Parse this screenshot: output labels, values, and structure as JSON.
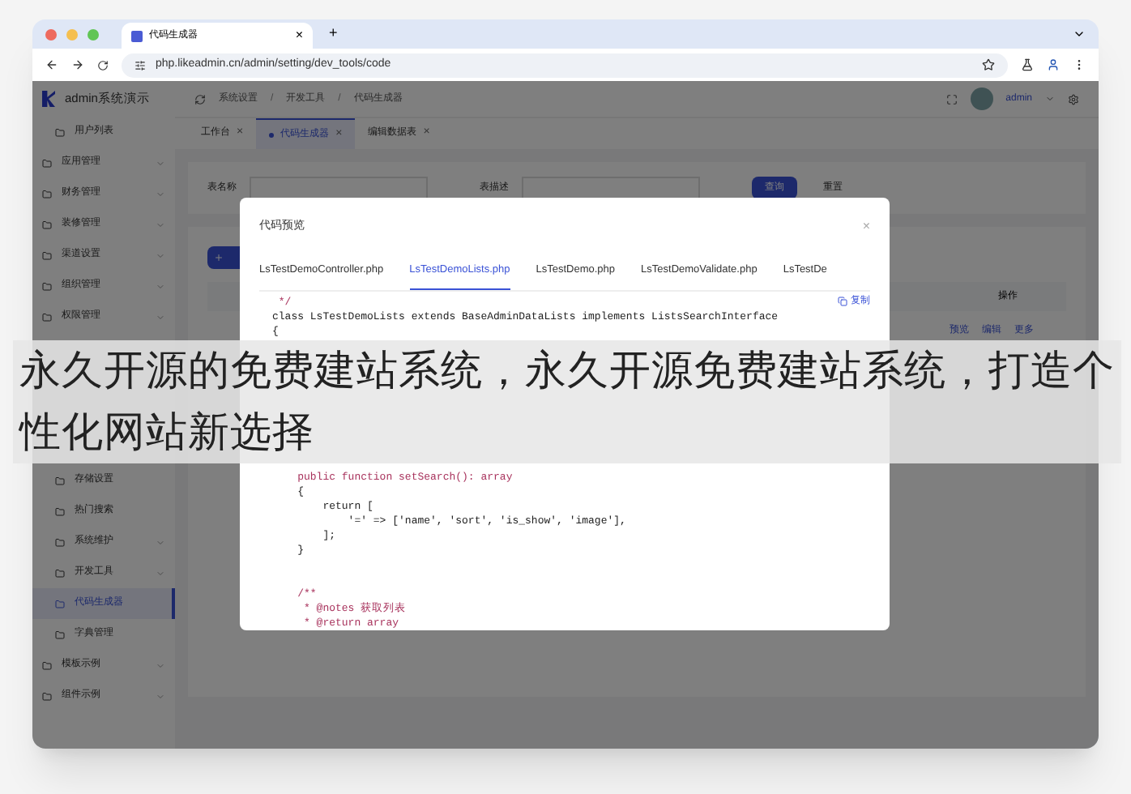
{
  "browser": {
    "tab_title": "代码生成器",
    "tab_close": "×",
    "new_tab": "+",
    "url": "php.likeadmin.cn/admin/setting/dev_tools/code"
  },
  "app": {
    "logo_text": "admin系统演示",
    "breadcrumb": [
      "系统设置",
      "开发工具",
      "代码生成器"
    ],
    "breadcrumb_separator": "/",
    "user": "admin"
  },
  "sidebar": {
    "items": [
      {
        "label": "用户列表",
        "sub": true,
        "selected": false,
        "caret": false
      },
      {
        "label": "应用管理",
        "sub": false,
        "selected": false,
        "caret": true
      },
      {
        "label": "财务管理",
        "sub": false,
        "selected": false,
        "caret": true
      },
      {
        "label": "装修管理",
        "sub": false,
        "selected": false,
        "caret": true
      },
      {
        "label": "渠道设置",
        "sub": false,
        "selected": false,
        "caret": true
      },
      {
        "label": "组织管理",
        "sub": false,
        "selected": false,
        "caret": true
      },
      {
        "label": "权限管理",
        "sub": false,
        "selected": false,
        "caret": true
      }
    ],
    "items_below_caption": [
      {
        "label": "存储设置",
        "sub": true,
        "selected": false,
        "caret": false
      },
      {
        "label": "热门搜索",
        "sub": true,
        "selected": false,
        "caret": false
      },
      {
        "label": "系统维护",
        "sub": true,
        "selected": false,
        "caret": true
      },
      {
        "label": "开发工具",
        "sub": true,
        "selected": false,
        "caret": true
      },
      {
        "label": "代码生成器",
        "sub": true,
        "selected": true,
        "caret": false
      },
      {
        "label": "字典管理",
        "sub": true,
        "selected": false,
        "caret": false
      },
      {
        "label": "模板示例",
        "sub": false,
        "selected": false,
        "caret": true
      },
      {
        "label": "组件示例",
        "sub": false,
        "selected": false,
        "caret": true
      }
    ]
  },
  "page_tabs": [
    {
      "label": "工作台",
      "close": "×",
      "selected": false
    },
    {
      "label": "代码生成器",
      "close": "×",
      "selected": true
    },
    {
      "label": "编辑数据表",
      "close": "×",
      "selected": false
    }
  ],
  "search_form": {
    "fields": [
      {
        "label": "表名称"
      },
      {
        "label": "表描述"
      }
    ],
    "buttons": [
      "查询",
      "重置"
    ]
  },
  "table": {
    "columns": [
      "操作"
    ],
    "row_actions": [
      "预览",
      "编辑",
      "更多"
    ]
  },
  "dialog": {
    "title": "代码预览",
    "close": "×",
    "copy": "复制",
    "tabs": [
      {
        "label": "LsTestDemoController.php",
        "selected": false
      },
      {
        "label": "LsTestDemoLists.php",
        "selected": true
      },
      {
        "label": "LsTestDemo.php",
        "selected": false
      },
      {
        "label": "LsTestDemoValidate.php",
        "selected": false
      },
      {
        "label": "LsTestDe",
        "selected": false
      }
    ],
    "code_lines": [
      {
        "text": " */",
        "kind": "comment"
      },
      {
        "text": "class LsTestDemoLists extends BaseAdminDataLists implements ListsSearchInterface",
        "kind": "code"
      },
      {
        "text": "{",
        "kind": "code"
      }
    ],
    "code_lines_below_caption": [
      {
        "text": "    public function setSearch(): array",
        "kind": "comment"
      },
      {
        "text": "    {",
        "kind": "code"
      },
      {
        "text": "        return [",
        "kind": "code"
      },
      {
        "text": "            '=' => ['name', 'sort', 'is_show', 'image'],",
        "kind": "code"
      },
      {
        "text": "        ];",
        "kind": "code"
      },
      {
        "text": "    }",
        "kind": "code"
      },
      {
        "kind": "blank"
      },
      {
        "kind": "blank"
      },
      {
        "text": "    /**",
        "kind": "comment"
      },
      {
        "text": "     * @notes 获取列表",
        "kind": "comment"
      },
      {
        "text": "     * @return array",
        "kind": "comment"
      }
    ]
  },
  "caption": "永久开源的免费建站系统，永久开源免费建站系统，打造个性化网站新选择"
}
